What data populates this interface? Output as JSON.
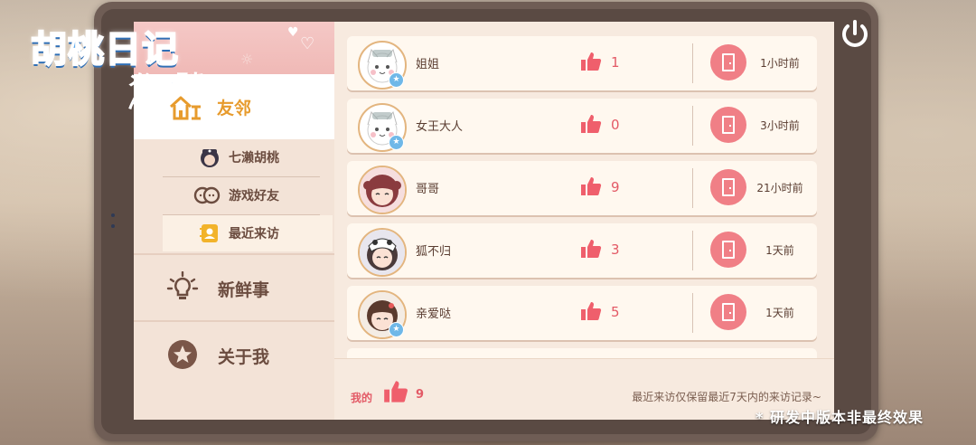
{
  "logo": {
    "title": "胡桃日记",
    "subtitle": "メンヘラちゃん"
  },
  "nav": {
    "main_tab": "友邻",
    "sub_items": [
      "七濑胡桃",
      "游戏好友",
      "最近来访"
    ],
    "active_sub": "最近来访",
    "news": "新鲜事",
    "about": "关于我"
  },
  "visitors": [
    {
      "name": "姐姐",
      "likes": "1",
      "time": "1小时前",
      "avatar": "white-cat-avatar"
    },
    {
      "name": "女王大人",
      "likes": "0",
      "time": "3小时前",
      "avatar": "white-cat-avatar"
    },
    {
      "name": "哥哥",
      "likes": "9",
      "time": "21小时前",
      "avatar": "girl-avatar"
    },
    {
      "name": "狐不归",
      "likes": "3",
      "time": "1天前",
      "avatar": "girl-avatar"
    },
    {
      "name": "亲爱哒",
      "likes": "5",
      "time": "1天前",
      "avatar": "girl-avatar"
    }
  ],
  "footer": {
    "my_label": "我的",
    "my_likes": "9",
    "note": "最近来访仅保留最近7天内的来访记录~"
  },
  "watermark": "* 研发中版本非最终效果",
  "colors": {
    "accent_pink": "#f07f86",
    "like_red": "#e35a66",
    "nav_active": "#e79b2d"
  }
}
